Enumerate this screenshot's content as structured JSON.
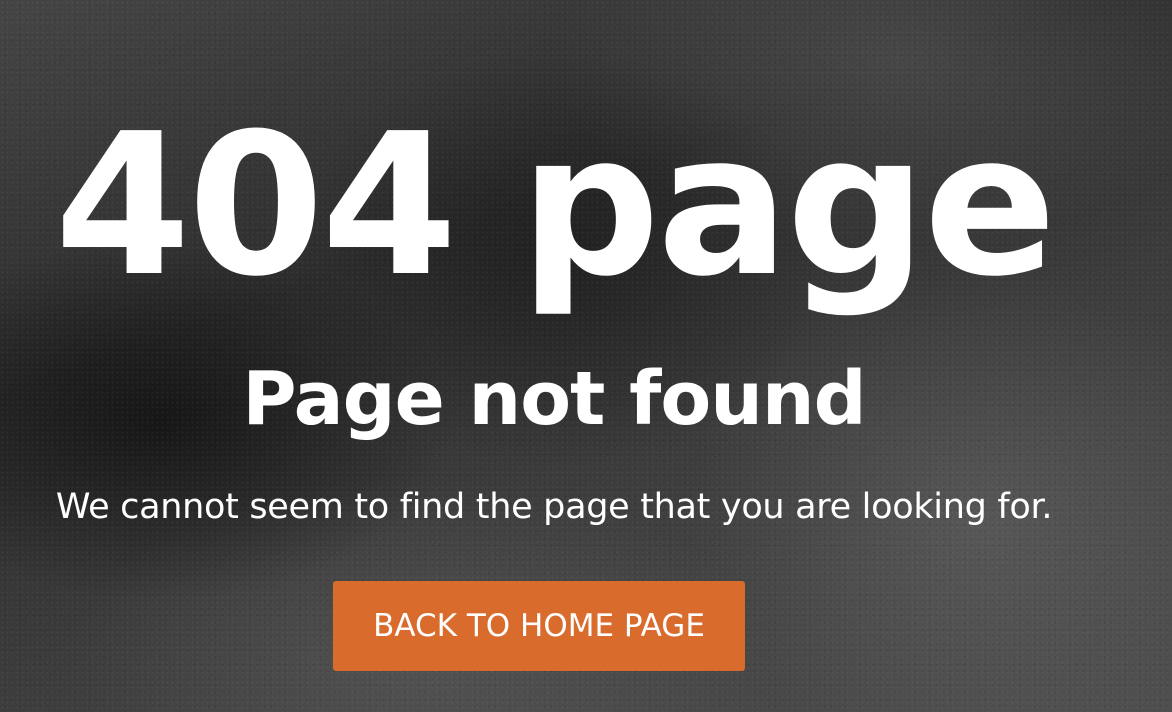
{
  "error_page": {
    "code_title": "404 page",
    "subtitle": "Page not found",
    "message": "We cannot seem to find the page that you are looking for.",
    "home_button_label": "BACK TO HOME PAGE"
  },
  "colors": {
    "button_accent": "#d96b2c",
    "text": "#ffffff",
    "background": "#3b3b3b"
  }
}
